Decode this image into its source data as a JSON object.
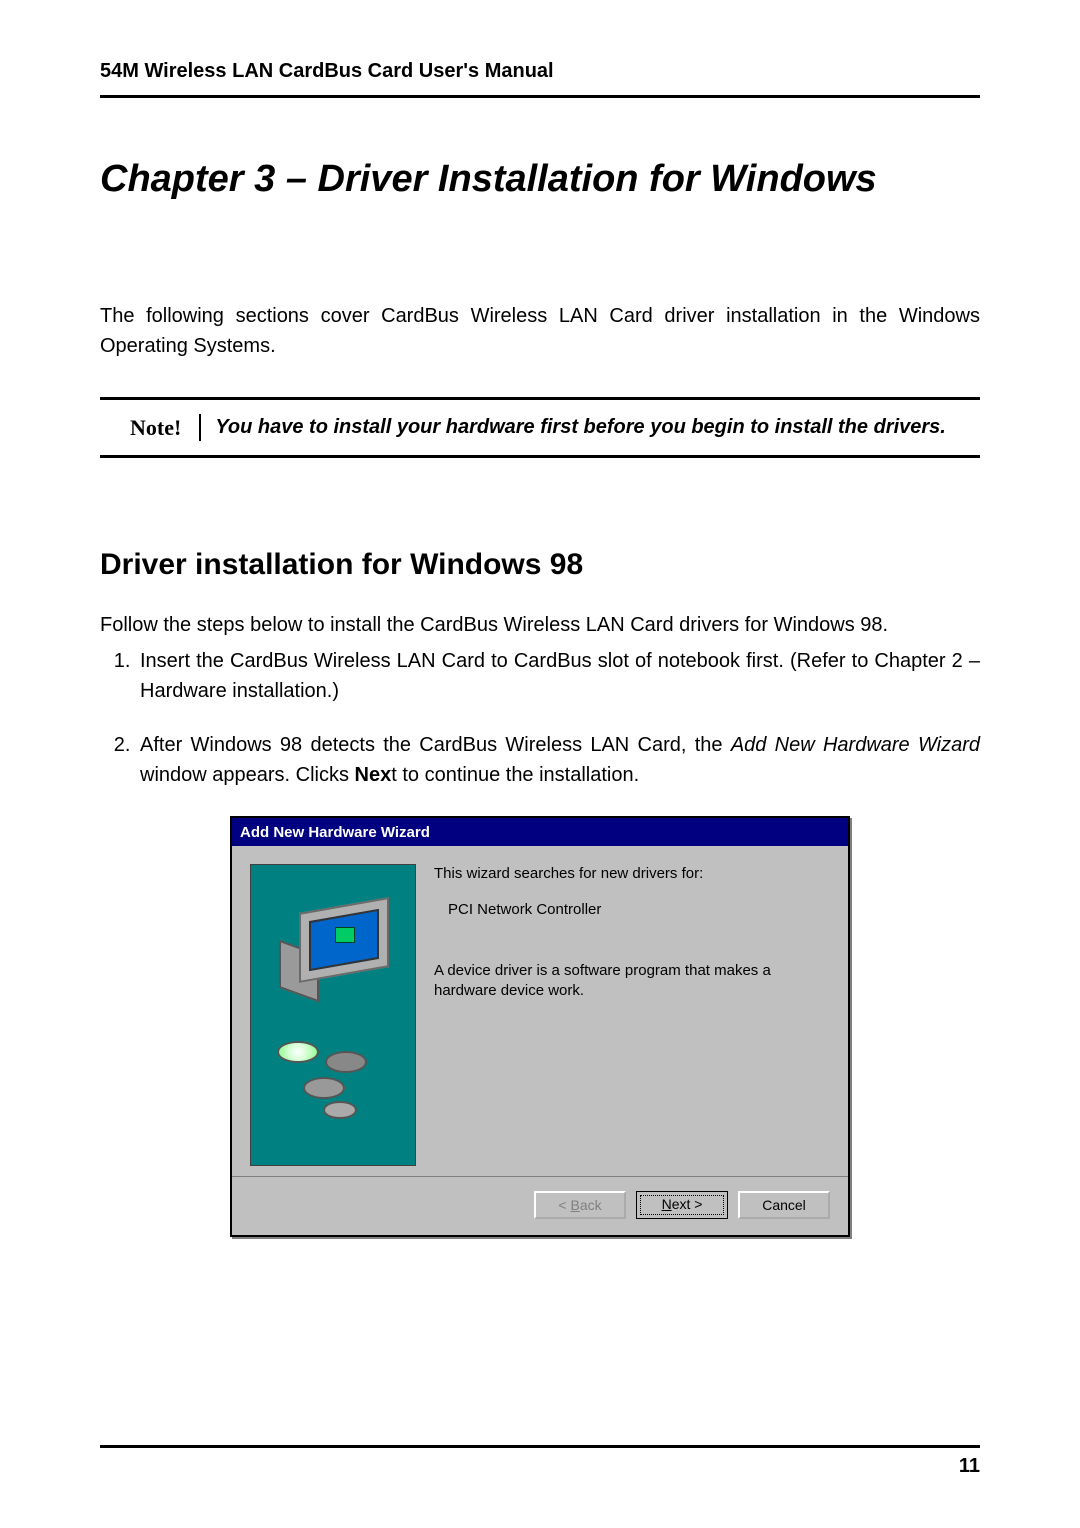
{
  "header": "54M Wireless LAN CardBus Card User's Manual",
  "chapter_title": "Chapter 3 – Driver Installation for Windows",
  "intro": "The following sections cover CardBus Wireless LAN Card driver installation in the Windows Operating Systems.",
  "note": {
    "label": "Note!",
    "text": "You have to install your hardware first before you begin to install the drivers."
  },
  "section_title": "Driver installation for Windows 98",
  "section_intro": "Follow the steps below to install the CardBus Wireless LAN Card drivers for Windows 98.",
  "steps": {
    "s1": "Insert the CardBus Wireless LAN Card to CardBus slot of notebook first. (Refer to Chapter 2 – Hardware installation.)",
    "s2_a": "After Windows 98 detects the CardBus Wireless LAN Card, the ",
    "s2_b": "Add New Hardware Wizard",
    "s2_c": " window appears. Clicks ",
    "s2_d": "Nex",
    "s2_e": "t to continue the installation."
  },
  "wizard": {
    "title": "Add New Hardware Wizard",
    "line1": "This wizard searches for new drivers for:",
    "device": "PCI Network Controller",
    "desc": "A device driver is a software program that makes a hardware device work.",
    "buttons": {
      "back_pre": "< ",
      "back_u": "B",
      "back_post": "ack",
      "next_pre": "",
      "next_u": "N",
      "next_post": "ext >",
      "cancel": "Cancel"
    }
  },
  "page_number": "11"
}
